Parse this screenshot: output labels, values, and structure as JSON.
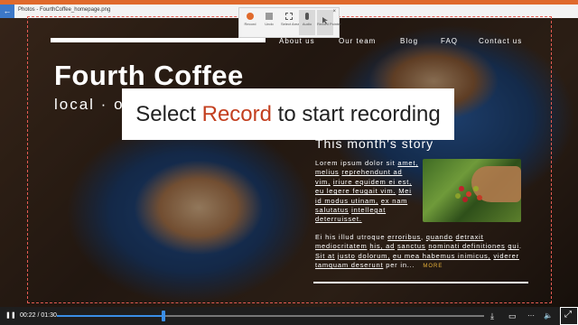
{
  "window": {
    "title": "Photos - FourthCoffee_homepage.png",
    "back_glyph": "←"
  },
  "site": {
    "nav": [
      "About us",
      "Our team",
      "Blog",
      "FAQ",
      "Contact us"
    ],
    "headline": "Fourth Coffee",
    "subline": "local · or",
    "story_title": "This month's story",
    "para1_plain_a": "Lorem ipsum dolor sit ",
    "para1_links": [
      "amet, melius",
      "reprehendunt ad vim,",
      "iriure equidem ei est,",
      "eu legere feugait vim.",
      "Mei id modus utinam,",
      "ex nam salutatus",
      "intellegat deterruisset."
    ],
    "para2_a": "Ei his illud utroque ",
    "para2_links": [
      "erroribus",
      "quando",
      "detraxit mediocritatem",
      "his, ad",
      "sanctus",
      "nominati definitiones",
      "qui",
      "Sit at",
      "justo",
      "dolorum,",
      "eu mea habemus inimicus,",
      "viderer tamquam deserunt"
    ],
    "para2_tail": " per in...",
    "more": "MORE"
  },
  "callout": {
    "before": "Select ",
    "accent": "Record",
    "after": " to start recording"
  },
  "toolbar": {
    "items": [
      "Record",
      "Undo",
      "Select Area",
      "Audio",
      "Record Pointer"
    ],
    "close": "×"
  },
  "player": {
    "time": "00:22 / 01:30",
    "progress": 0.25,
    "play_glyph": "❚❚",
    "download_glyph": "⤓",
    "captions_glyph": "▭",
    "volume_glyph": "🔈",
    "more_glyph": "···",
    "fullscreen_glyph": "⤢"
  },
  "colors": {
    "accent": "#e06a2c",
    "record": "#c33f1f",
    "progress": "#3a8ee6"
  }
}
